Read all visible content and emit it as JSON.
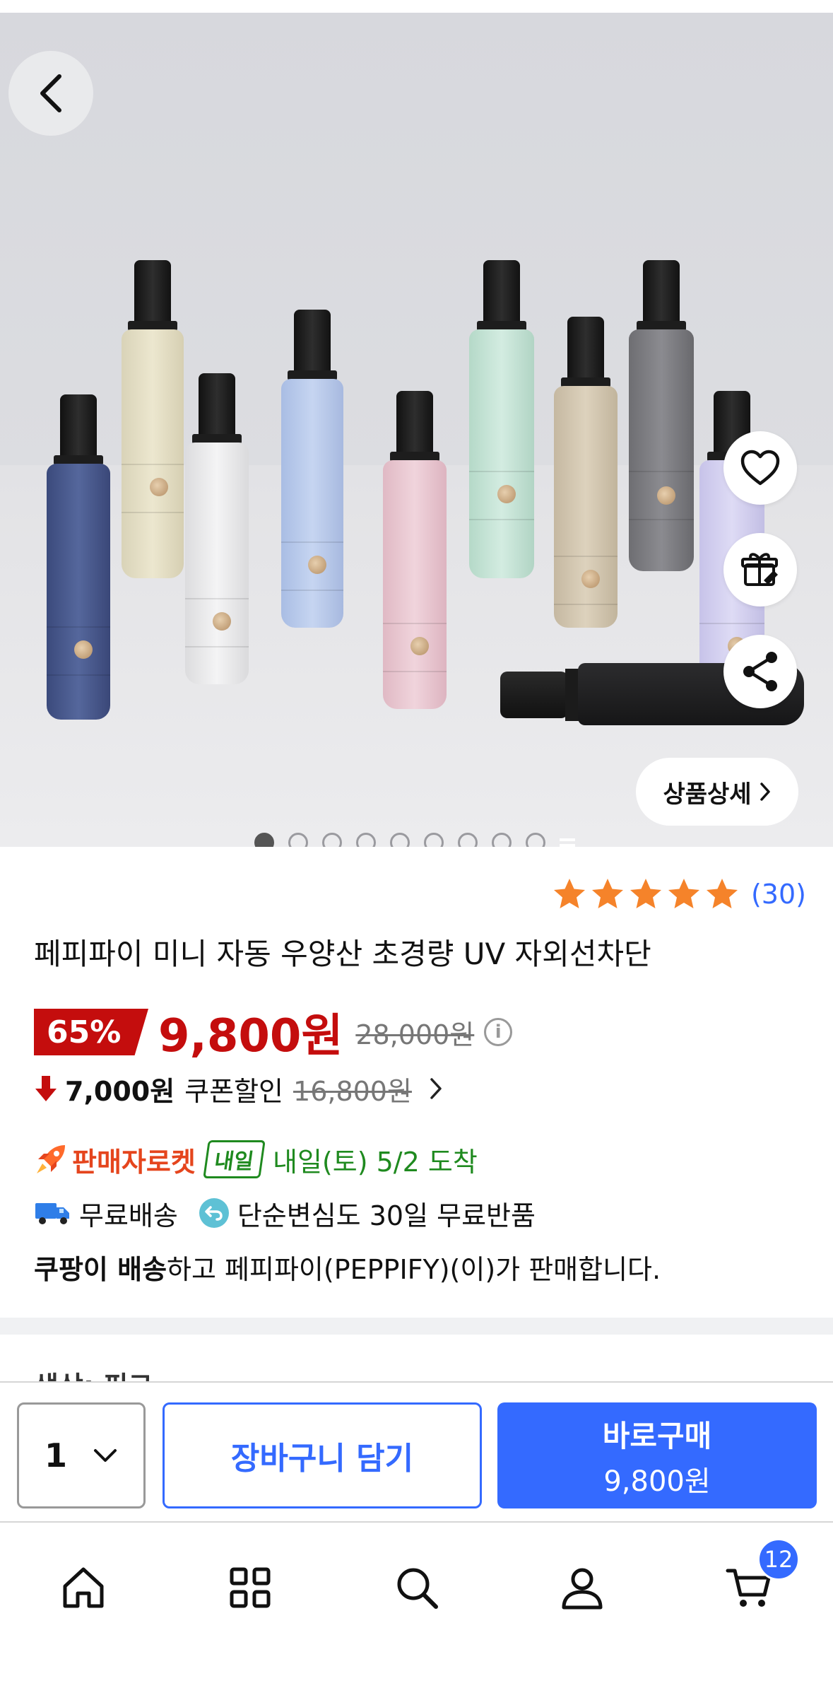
{
  "hero": {
    "detail_button_label": "상품상세",
    "image_count": 10,
    "active_image_index": 0
  },
  "rating": {
    "stars": 5,
    "count_label": "(30)"
  },
  "product": {
    "title": "페피파이 미니 자동 우양산 초경량 UV 자외선차단",
    "discount_rate": "65%",
    "price": "9,800원",
    "original_price": "28,000원",
    "coupon": {
      "amount": "7,000원",
      "label": "쿠폰할인",
      "price_before": "16,800원"
    },
    "delivery": {
      "rocket_label": "판매자로켓",
      "naeil_badge": "내일",
      "arrival": "내일(토) 5/2 도착"
    },
    "shipping": {
      "free_shipping": "무료배송",
      "free_return": "단순변심도 30일 무료반품"
    },
    "seller": {
      "bold_part": "쿠팡이 배송",
      "rest": "하고 페피파이(PEPPIFY)(이)가 판매합니다."
    }
  },
  "next_section_peek": "색상: 핑크",
  "buy_bar": {
    "quantity": "1",
    "cart_label": "장바구니 담기",
    "buy_label": "바로구매",
    "buy_price": "9,800원"
  },
  "tabbar": {
    "cart_badge": "12"
  },
  "colors": {
    "accent_blue": "#346aff",
    "price_red": "#c40d0d",
    "delivery_green": "#1f8a1f",
    "star_orange": "#f5832a"
  }
}
